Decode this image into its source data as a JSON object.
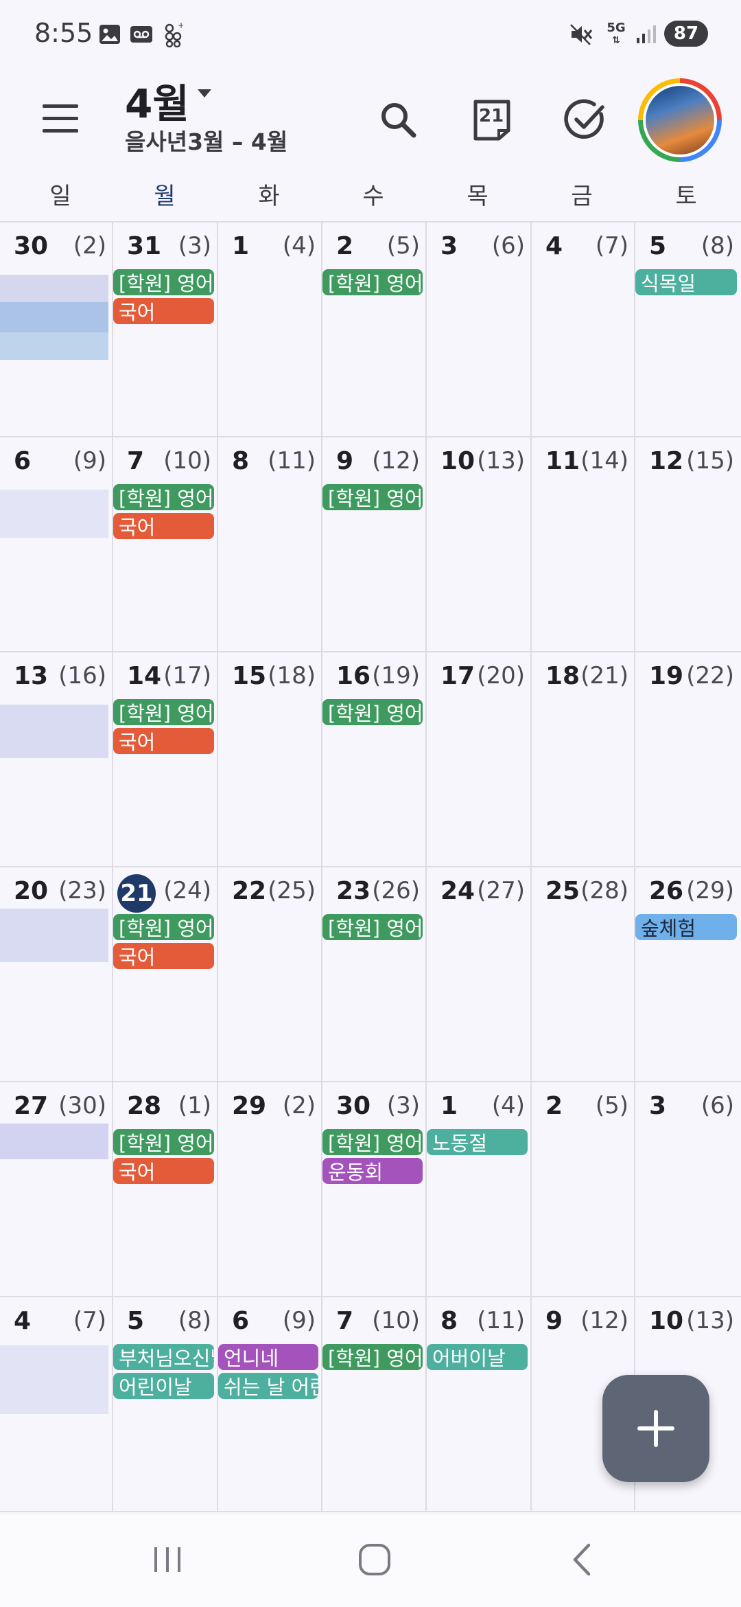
{
  "status_bar": {
    "time": "8:55",
    "icons": [
      "gallery-icon",
      "voicemail-icon",
      "sync-icon",
      "mute-icon",
      "5g-icon",
      "signal-icon"
    ],
    "network": "5G",
    "battery": "87"
  },
  "app_bar": {
    "month_title": "4월",
    "lunar_range": "을사년3월 – 4월",
    "today_date_icon": "21"
  },
  "weekdays": [
    "일",
    "월",
    "화",
    "수",
    "목",
    "금",
    "토"
  ],
  "weeks": [
    {
      "days": [
        {
          "date": "30",
          "lunar": "(2)"
        },
        {
          "date": "31",
          "lunar": "(3)"
        },
        {
          "date": "1",
          "lunar": "(4)"
        },
        {
          "date": "2",
          "lunar": "(5)"
        },
        {
          "date": "3",
          "lunar": "(6)"
        },
        {
          "date": "4",
          "lunar": "(7)"
        },
        {
          "date": "5",
          "lunar": "(8)"
        }
      ]
    },
    {
      "days": [
        {
          "date": "6",
          "lunar": "(9)"
        },
        {
          "date": "7",
          "lunar": "(10)"
        },
        {
          "date": "8",
          "lunar": "(11)"
        },
        {
          "date": "9",
          "lunar": "(12)"
        },
        {
          "date": "10",
          "lunar": "(13)"
        },
        {
          "date": "11",
          "lunar": "(14)"
        },
        {
          "date": "12",
          "lunar": "(15)"
        }
      ]
    },
    {
      "days": [
        {
          "date": "13",
          "lunar": "(16)"
        },
        {
          "date": "14",
          "lunar": "(17)"
        },
        {
          "date": "15",
          "lunar": "(18)"
        },
        {
          "date": "16",
          "lunar": "(19)"
        },
        {
          "date": "17",
          "lunar": "(20)"
        },
        {
          "date": "18",
          "lunar": "(21)"
        },
        {
          "date": "19",
          "lunar": "(22)"
        }
      ]
    },
    {
      "days": [
        {
          "date": "20",
          "lunar": "(23)"
        },
        {
          "date": "21",
          "lunar": "(24)"
        },
        {
          "date": "22",
          "lunar": "(25)"
        },
        {
          "date": "23",
          "lunar": "(26)"
        },
        {
          "date": "24",
          "lunar": "(27)"
        },
        {
          "date": "25",
          "lunar": "(28)"
        },
        {
          "date": "26",
          "lunar": "(29)"
        }
      ]
    },
    {
      "days": [
        {
          "date": "27",
          "lunar": "(30)"
        },
        {
          "date": "28",
          "lunar": "(1)"
        },
        {
          "date": "29",
          "lunar": "(2)"
        },
        {
          "date": "30",
          "lunar": "(3)"
        },
        {
          "date": "1",
          "lunar": "(4)"
        },
        {
          "date": "2",
          "lunar": "(5)"
        },
        {
          "date": "3",
          "lunar": "(6)"
        }
      ]
    },
    {
      "days": [
        {
          "date": "4",
          "lunar": "(7)"
        },
        {
          "date": "5",
          "lunar": "(8)"
        },
        {
          "date": "6",
          "lunar": "(9)"
        },
        {
          "date": "7",
          "lunar": "(10)"
        },
        {
          "date": "8",
          "lunar": "(11)"
        },
        {
          "date": "9",
          "lunar": "(12)"
        },
        {
          "date": "10",
          "lunar": "(13)"
        }
      ]
    }
  ],
  "events": [
    {
      "week": 0,
      "day": 1,
      "slot": 0,
      "label": "[학원] 영어",
      "color": "#3E9A5E"
    },
    {
      "week": 0,
      "day": 1,
      "slot": 1,
      "label": "국어",
      "color": "#E45B39"
    },
    {
      "week": 0,
      "day": 3,
      "slot": 0,
      "label": "[학원] 영어",
      "color": "#3E9A5E"
    },
    {
      "week": 0,
      "day": 6,
      "slot": 0,
      "label": "식목일",
      "color": "#4DAF9E"
    },
    {
      "week": 1,
      "day": 1,
      "slot": 0,
      "label": "[학원] 영어",
      "color": "#3E9A5E"
    },
    {
      "week": 1,
      "day": 1,
      "slot": 1,
      "label": "국어",
      "color": "#E45B39"
    },
    {
      "week": 1,
      "day": 3,
      "slot": 0,
      "label": "[학원] 영어",
      "color": "#3E9A5E"
    },
    {
      "week": 2,
      "day": 1,
      "slot": 0,
      "label": "[학원] 영어",
      "color": "#3E9A5E"
    },
    {
      "week": 2,
      "day": 1,
      "slot": 1,
      "label": "국어",
      "color": "#E45B39"
    },
    {
      "week": 2,
      "day": 3,
      "slot": 0,
      "label": "[학원] 영어",
      "color": "#3E9A5E"
    },
    {
      "week": 3,
      "day": 1,
      "slot": 0,
      "label": "[학원] 영어",
      "color": "#3E9A5E"
    },
    {
      "week": 3,
      "day": 1,
      "slot": 1,
      "label": "국어",
      "color": "#E45B39"
    },
    {
      "week": 3,
      "day": 3,
      "slot": 0,
      "label": "[학원] 영어",
      "color": "#3E9A5E"
    },
    {
      "week": 3,
      "day": 6,
      "slot": 0,
      "label": "숲체험",
      "color": "#6FAFEA",
      "text_color": "#1d2a40"
    },
    {
      "week": 4,
      "day": 1,
      "slot": 0,
      "label": "[학원] 영어",
      "color": "#3E9A5E"
    },
    {
      "week": 4,
      "day": 1,
      "slot": 1,
      "label": "국어",
      "color": "#E45B39"
    },
    {
      "week": 4,
      "day": 3,
      "slot": 0,
      "label": "[학원] 영어",
      "color": "#3E9A5E"
    },
    {
      "week": 4,
      "day": 3,
      "slot": 1,
      "label": "운동회",
      "color": "#A453BD"
    },
    {
      "week": 4,
      "day": 4,
      "slot": 0,
      "label": "노동절",
      "color": "#4DAF9E"
    },
    {
      "week": 5,
      "day": 1,
      "slot": 0,
      "label": "부처님오신날",
      "color": "#4DAF9E"
    },
    {
      "week": 5,
      "day": 1,
      "slot": 1,
      "label": "어린이날",
      "color": "#4DAF9E"
    },
    {
      "week": 5,
      "day": 2,
      "slot": 0,
      "label": "언니네",
      "color": "#A453BD"
    },
    {
      "week": 5,
      "day": 2,
      "slot": 1,
      "label": "쉬는 날 어린이날",
      "color": "#4DAF9E"
    },
    {
      "week": 5,
      "day": 3,
      "slot": 0,
      "label": "[학원] 영어",
      "color": "#3E9A5E"
    },
    {
      "week": 5,
      "day": 4,
      "slot": 0,
      "label": "어버이날",
      "color": "#4DAF9E"
    }
  ],
  "today": {
    "week": 3,
    "day": 1
  },
  "colors": {
    "background": "#F7F6FC",
    "today_circle": "#1F3A68",
    "fab": "#5E6574"
  }
}
